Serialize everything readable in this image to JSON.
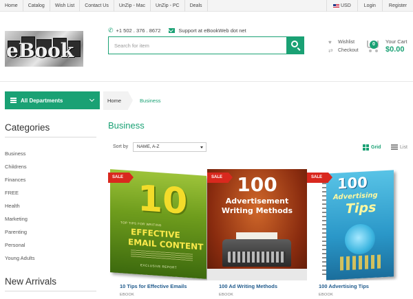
{
  "topbar": {
    "links": [
      "Home",
      "Catalog",
      "Wish List",
      "Contact Us",
      "UnZip - Mac",
      "UnZip - PC",
      "Deals"
    ],
    "currency": "USD",
    "login": "Login",
    "register": "Register"
  },
  "header": {
    "logo_text": "eBook",
    "phone": "+1 502 . 376 . 8672",
    "support": "Support at eBookWeb dot net",
    "search_placeholder": "Search for item",
    "wishlist": "Wishlist",
    "checkout": "Checkout",
    "cart_label": "Your Cart",
    "cart_count": "0",
    "cart_total": "$0.00"
  },
  "sidebar": {
    "departments_label": "All Departments",
    "categories_title": "Categories",
    "categories": [
      "Business",
      "Childrens",
      "Finances",
      "FREE",
      "Health",
      "Marketing",
      "Parenting",
      "Personal",
      "Young Adults"
    ],
    "new_arrivals_title": "New Arrivals"
  },
  "main": {
    "breadcrumb": [
      "Home",
      "Business"
    ],
    "title": "Business",
    "sort_label": "Sort by",
    "sort_value": "NAME, A-Z",
    "view_grid": "Grid",
    "view_list": "List"
  },
  "products": [
    {
      "badge": "SALE",
      "title": "10 Tips for Effective Emails",
      "category": "EBOOK",
      "cover": {
        "number": "10",
        "tagline": "TOP TIPS FOR WRITING",
        "line1": "EFFECTIVE",
        "line2": "EMAIL CONTENT",
        "footer": "EXCLUSIVE REPORT"
      }
    },
    {
      "badge": "SALE",
      "title": "100 Ad Writing Methods",
      "category": "EBOOK",
      "cover": {
        "number": "100",
        "line1": "Advertisement",
        "line2": "Writing Methods"
      }
    },
    {
      "badge": "SALE",
      "title": "100 Advertising Tips",
      "category": "EBOOK",
      "cover": {
        "number": "100",
        "line1": "Advertising",
        "line2": "Tips"
      }
    }
  ],
  "colors": {
    "accent": "#1aa174",
    "sale": "#d9281e",
    "link": "#1f5a8c"
  },
  "icons": [
    "phone-icon",
    "mail-icon",
    "search-icon",
    "heart-icon",
    "shuffle-icon",
    "cart-icon",
    "menu-icon",
    "chevron-down-icon",
    "grid-icon",
    "list-icon",
    "flag-icon"
  ]
}
